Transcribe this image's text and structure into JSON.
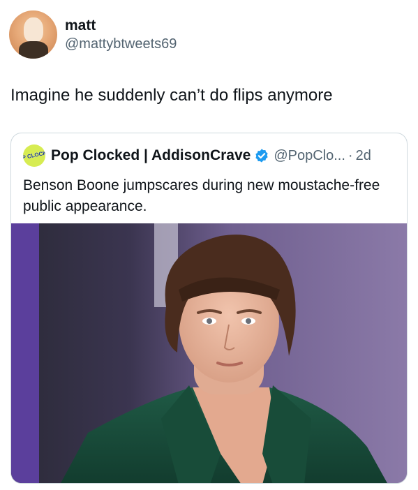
{
  "tweet": {
    "author_name": "matt",
    "author_handle": "@mattybtweets69",
    "text": "Imagine he suddenly can’t do flips anymore"
  },
  "quote": {
    "avatar_text": "POP CLOCKED",
    "name": "Pop Clocked | AddisonCrave",
    "handle": "@PopClo...",
    "separator": "·",
    "time": "2d",
    "text": "Benson Boone jumpscares during new moustache-free public appearance."
  },
  "colors": {
    "text": "#0f1419",
    "secondary": "#536471",
    "border": "#cfd9de",
    "verified": "#1d9bf0"
  }
}
